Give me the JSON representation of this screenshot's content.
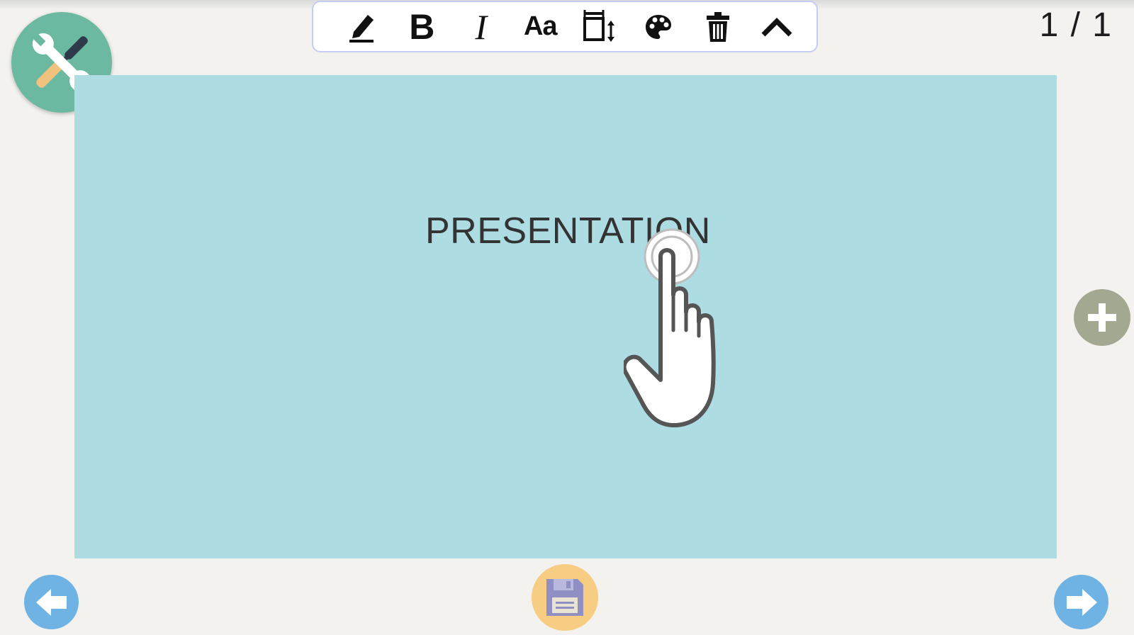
{
  "toolbar": {
    "items": [
      {
        "icon": "pen-icon"
      },
      {
        "icon": "bold-icon",
        "label": "B"
      },
      {
        "icon": "italic-icon",
        "label": "I"
      },
      {
        "icon": "font-size-icon",
        "label": "Aa"
      },
      {
        "icon": "resize-icon"
      },
      {
        "icon": "palette-icon"
      },
      {
        "icon": "trash-icon"
      },
      {
        "icon": "collapse-chevron-icon"
      }
    ]
  },
  "page_counter": "1 / 1",
  "slide": {
    "text": "PRESENTATION",
    "background": "#aedce3"
  },
  "colors": {
    "tools_button": "#6bb9a0",
    "add_button": "#a3a890",
    "nav_buttons": "#6fb2e4",
    "save_button": "#f6cd82",
    "toolbar_border": "#c6cdf4"
  },
  "icons": {
    "tools": "wrench-screwdriver-icon",
    "add": "plus-icon",
    "prev": "arrow-left-icon",
    "next": "arrow-right-icon",
    "save": "floppy-disk-icon",
    "gesture": "tap-hand-icon"
  }
}
